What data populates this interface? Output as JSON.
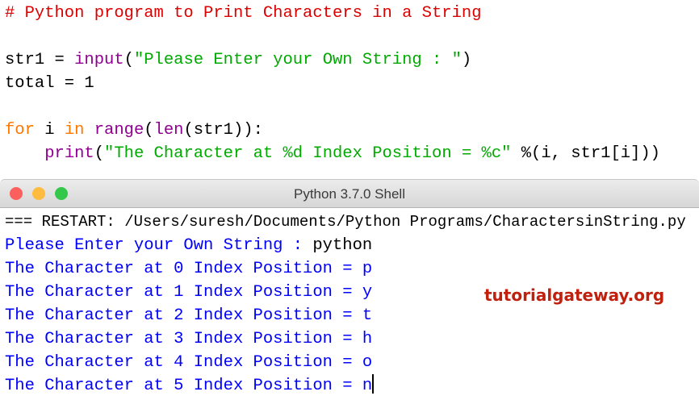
{
  "editor": {
    "lines": [
      [
        {
          "c": "cm",
          "t": "# Python program to Print Characters in a String"
        }
      ],
      [],
      [
        {
          "c": "df",
          "t": "str1 = "
        },
        {
          "c": "bi",
          "t": "input"
        },
        {
          "c": "df",
          "t": "("
        },
        {
          "c": "st",
          "t": "\"Please Enter your Own String : \""
        },
        {
          "c": "df",
          "t": ")"
        }
      ],
      [
        {
          "c": "df",
          "t": "total = 1"
        }
      ],
      [],
      [
        {
          "c": "kw",
          "t": "for"
        },
        {
          "c": "df",
          "t": " i "
        },
        {
          "c": "kw",
          "t": "in"
        },
        {
          "c": "df",
          "t": " "
        },
        {
          "c": "bi",
          "t": "range"
        },
        {
          "c": "df",
          "t": "("
        },
        {
          "c": "bi",
          "t": "len"
        },
        {
          "c": "df",
          "t": "(str1)):"
        }
      ],
      [
        {
          "c": "df",
          "t": "    "
        },
        {
          "c": "bi",
          "t": "print"
        },
        {
          "c": "df",
          "t": "("
        },
        {
          "c": "st",
          "t": "\"The Character at %d Index Position = %c\""
        },
        {
          "c": "df",
          "t": " %(i, str1[i]))"
        }
      ]
    ]
  },
  "window": {
    "title": "Python 3.7.0 Shell",
    "colors": {
      "close": "#fc605c",
      "minimize": "#fdbc40",
      "zoom": "#34c84a"
    }
  },
  "shell": {
    "restart": "=== RESTART: /Users/suresh/Documents/Python Programs/CharactersinString.py",
    "prompt": "Please Enter your Own String : ",
    "input": "python",
    "outputs": [
      "The Character at 0 Index Position = p",
      "The Character at 1 Index Position = y",
      "The Character at 2 Index Position = t",
      "The Character at 3 Index Position = h",
      "The Character at 4 Index Position = o",
      "The Character at 5 Index Position = n"
    ]
  },
  "watermark": "tutorialgateway.org"
}
